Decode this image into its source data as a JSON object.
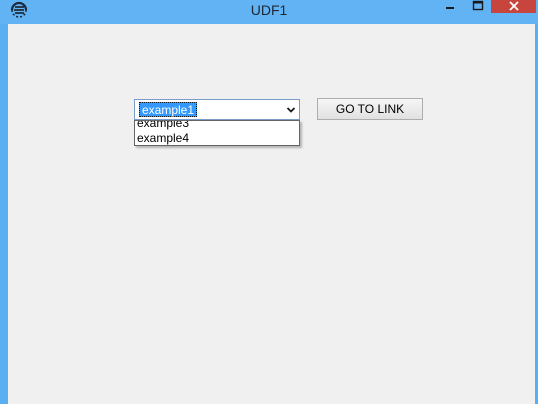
{
  "window": {
    "title": "UDF1",
    "icon": "autoit-icon"
  },
  "controls": {
    "minimize_icon": "minimize-icon",
    "maximize_icon": "maximize-icon",
    "close_icon": "close-icon"
  },
  "combo": {
    "selected_value": "example1",
    "arrow_icon": "chevron-down-icon",
    "dropdown_items": [
      "example3",
      "example4"
    ]
  },
  "button": {
    "label": "GO TO LINK"
  },
  "colors": {
    "title_bar": "#61b3f4",
    "close_button": "#c7453d",
    "selection": "#3399ff",
    "client_background": "#f0f0f0"
  }
}
